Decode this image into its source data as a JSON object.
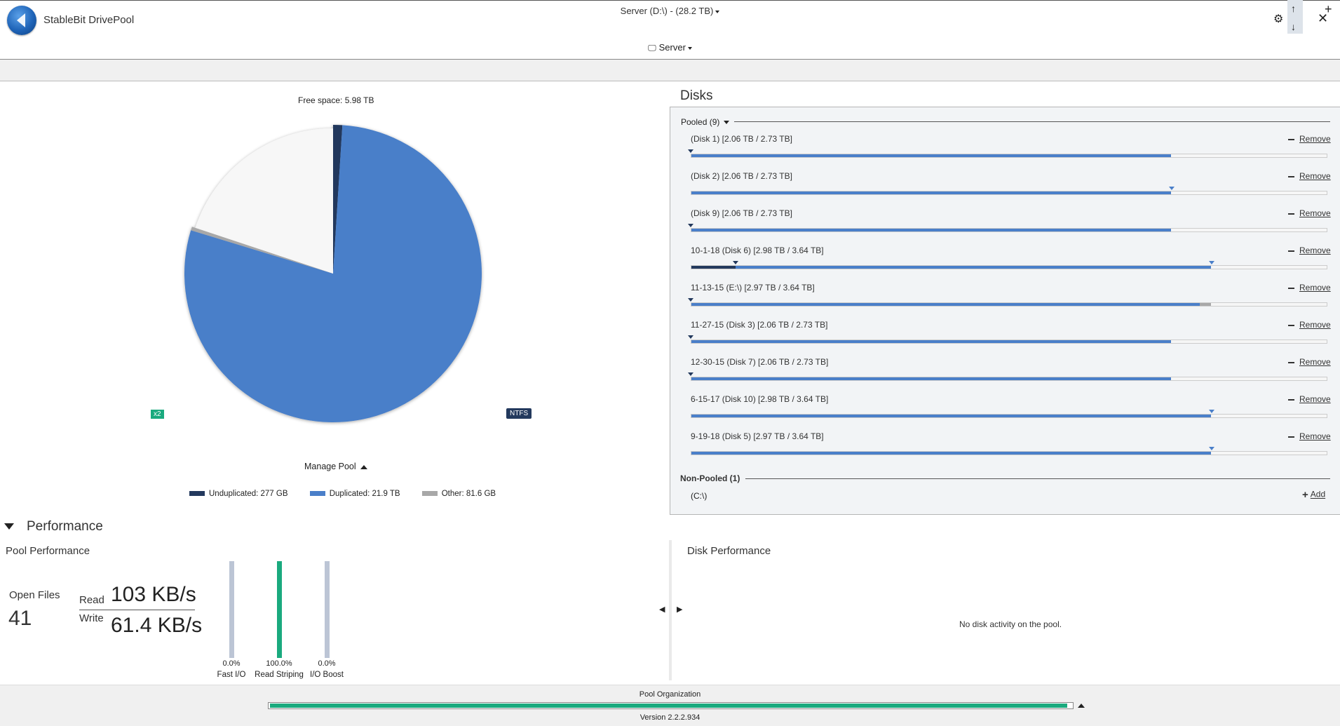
{
  "app": {
    "title": "StableBit DrivePool"
  },
  "menu": {
    "server_label": "Server"
  },
  "pool": {
    "selector_label": "Server (D:\\) - (28.2 TB)"
  },
  "pie": {
    "free_space_label": "Free space: 5.98 TB",
    "duplication_badge": "x2",
    "filesystem_badge": "NTFS",
    "manage_pool_label": "Manage Pool",
    "legend": {
      "unduplicated": "Unduplicated: 277 GB",
      "duplicated": "Duplicated: 21.9 TB",
      "other": "Other: 81.6 GB"
    },
    "colors": {
      "unduplicated": "#23395d",
      "duplicated": "#4a7fc9",
      "other": "#a8a8a8",
      "free": "#f7f7f7"
    }
  },
  "disks": {
    "title": "Disks",
    "pooled_header": "Pooled (9)",
    "remove_label": "Remove",
    "pooled": [
      {
        "name": "(Disk 1) [2.06 TB / 2.73 TB]",
        "fill": 0.755,
        "dark": 0.0,
        "other": 0.0,
        "target": 0.0,
        "target_color": "dark"
      },
      {
        "name": "(Disk 2) [2.06 TB / 2.73 TB]",
        "fill": 0.755,
        "dark": 0.0,
        "other": 0.0,
        "target": 0.755,
        "target_color": "blue"
      },
      {
        "name": "(Disk 9) [2.06 TB / 2.73 TB]",
        "fill": 0.755,
        "dark": 0.0,
        "other": 0.0,
        "target": 0.0,
        "target_color": "dark"
      },
      {
        "name": "10-1-18 (Disk 6) [2.98 TB / 3.64 TB]",
        "fill": 0.818,
        "dark": 0.07,
        "other": 0.0,
        "target": 0.818,
        "target_color": "blue"
      },
      {
        "name": "11-13-15 (E:\\) [2.97 TB / 3.64 TB]",
        "fill": 0.8,
        "dark": 0.0,
        "other": 0.018,
        "target": 0.0,
        "target_color": "dark"
      },
      {
        "name": "11-27-15 (Disk 3) [2.06 TB / 2.73 TB]",
        "fill": 0.755,
        "dark": 0.0,
        "other": 0.0,
        "target": 0.0,
        "target_color": "dark"
      },
      {
        "name": "12-30-15 (Disk 7) [2.06 TB / 2.73 TB]",
        "fill": 0.755,
        "dark": 0.0,
        "other": 0.0,
        "target": 0.0,
        "target_color": "dark"
      },
      {
        "name": "6-15-17 (Disk 10) [2.98 TB / 3.64 TB]",
        "fill": 0.818,
        "dark": 0.0,
        "other": 0.0,
        "target": 0.818,
        "target_color": "blue"
      },
      {
        "name": "9-19-18 (Disk 5) [2.97 TB / 3.64 TB]",
        "fill": 0.818,
        "dark": 0.0,
        "other": 0.0,
        "target": 0.818,
        "target_color": "blue"
      }
    ],
    "nonpooled_header": "Non-Pooled (1)",
    "nonpooled": [
      {
        "name": "(C:\\)"
      }
    ],
    "add_label": "Add"
  },
  "performance": {
    "section_title": "Performance",
    "pool_title": "Pool Performance",
    "open_files_label": "Open Files",
    "open_files_count": "41",
    "read_label": "Read",
    "read_value": "103 KB/s",
    "write_label": "Write",
    "write_value": "61.4 KB/s",
    "bars": [
      {
        "pct_label": "0.0%",
        "label": "Fast I/O",
        "value": 0.0
      },
      {
        "pct_label": "100.0%",
        "label": "Read Striping",
        "value": 1.0
      },
      {
        "pct_label": "0.0%",
        "label": "I/O Boost",
        "value": 0.0
      }
    ],
    "disk_title": "Disk Performance",
    "no_activity": "No disk activity on the pool."
  },
  "footer": {
    "organization_label": "Pool Organization",
    "organization_progress": 0.995,
    "version": "Version 2.2.2.934"
  }
}
